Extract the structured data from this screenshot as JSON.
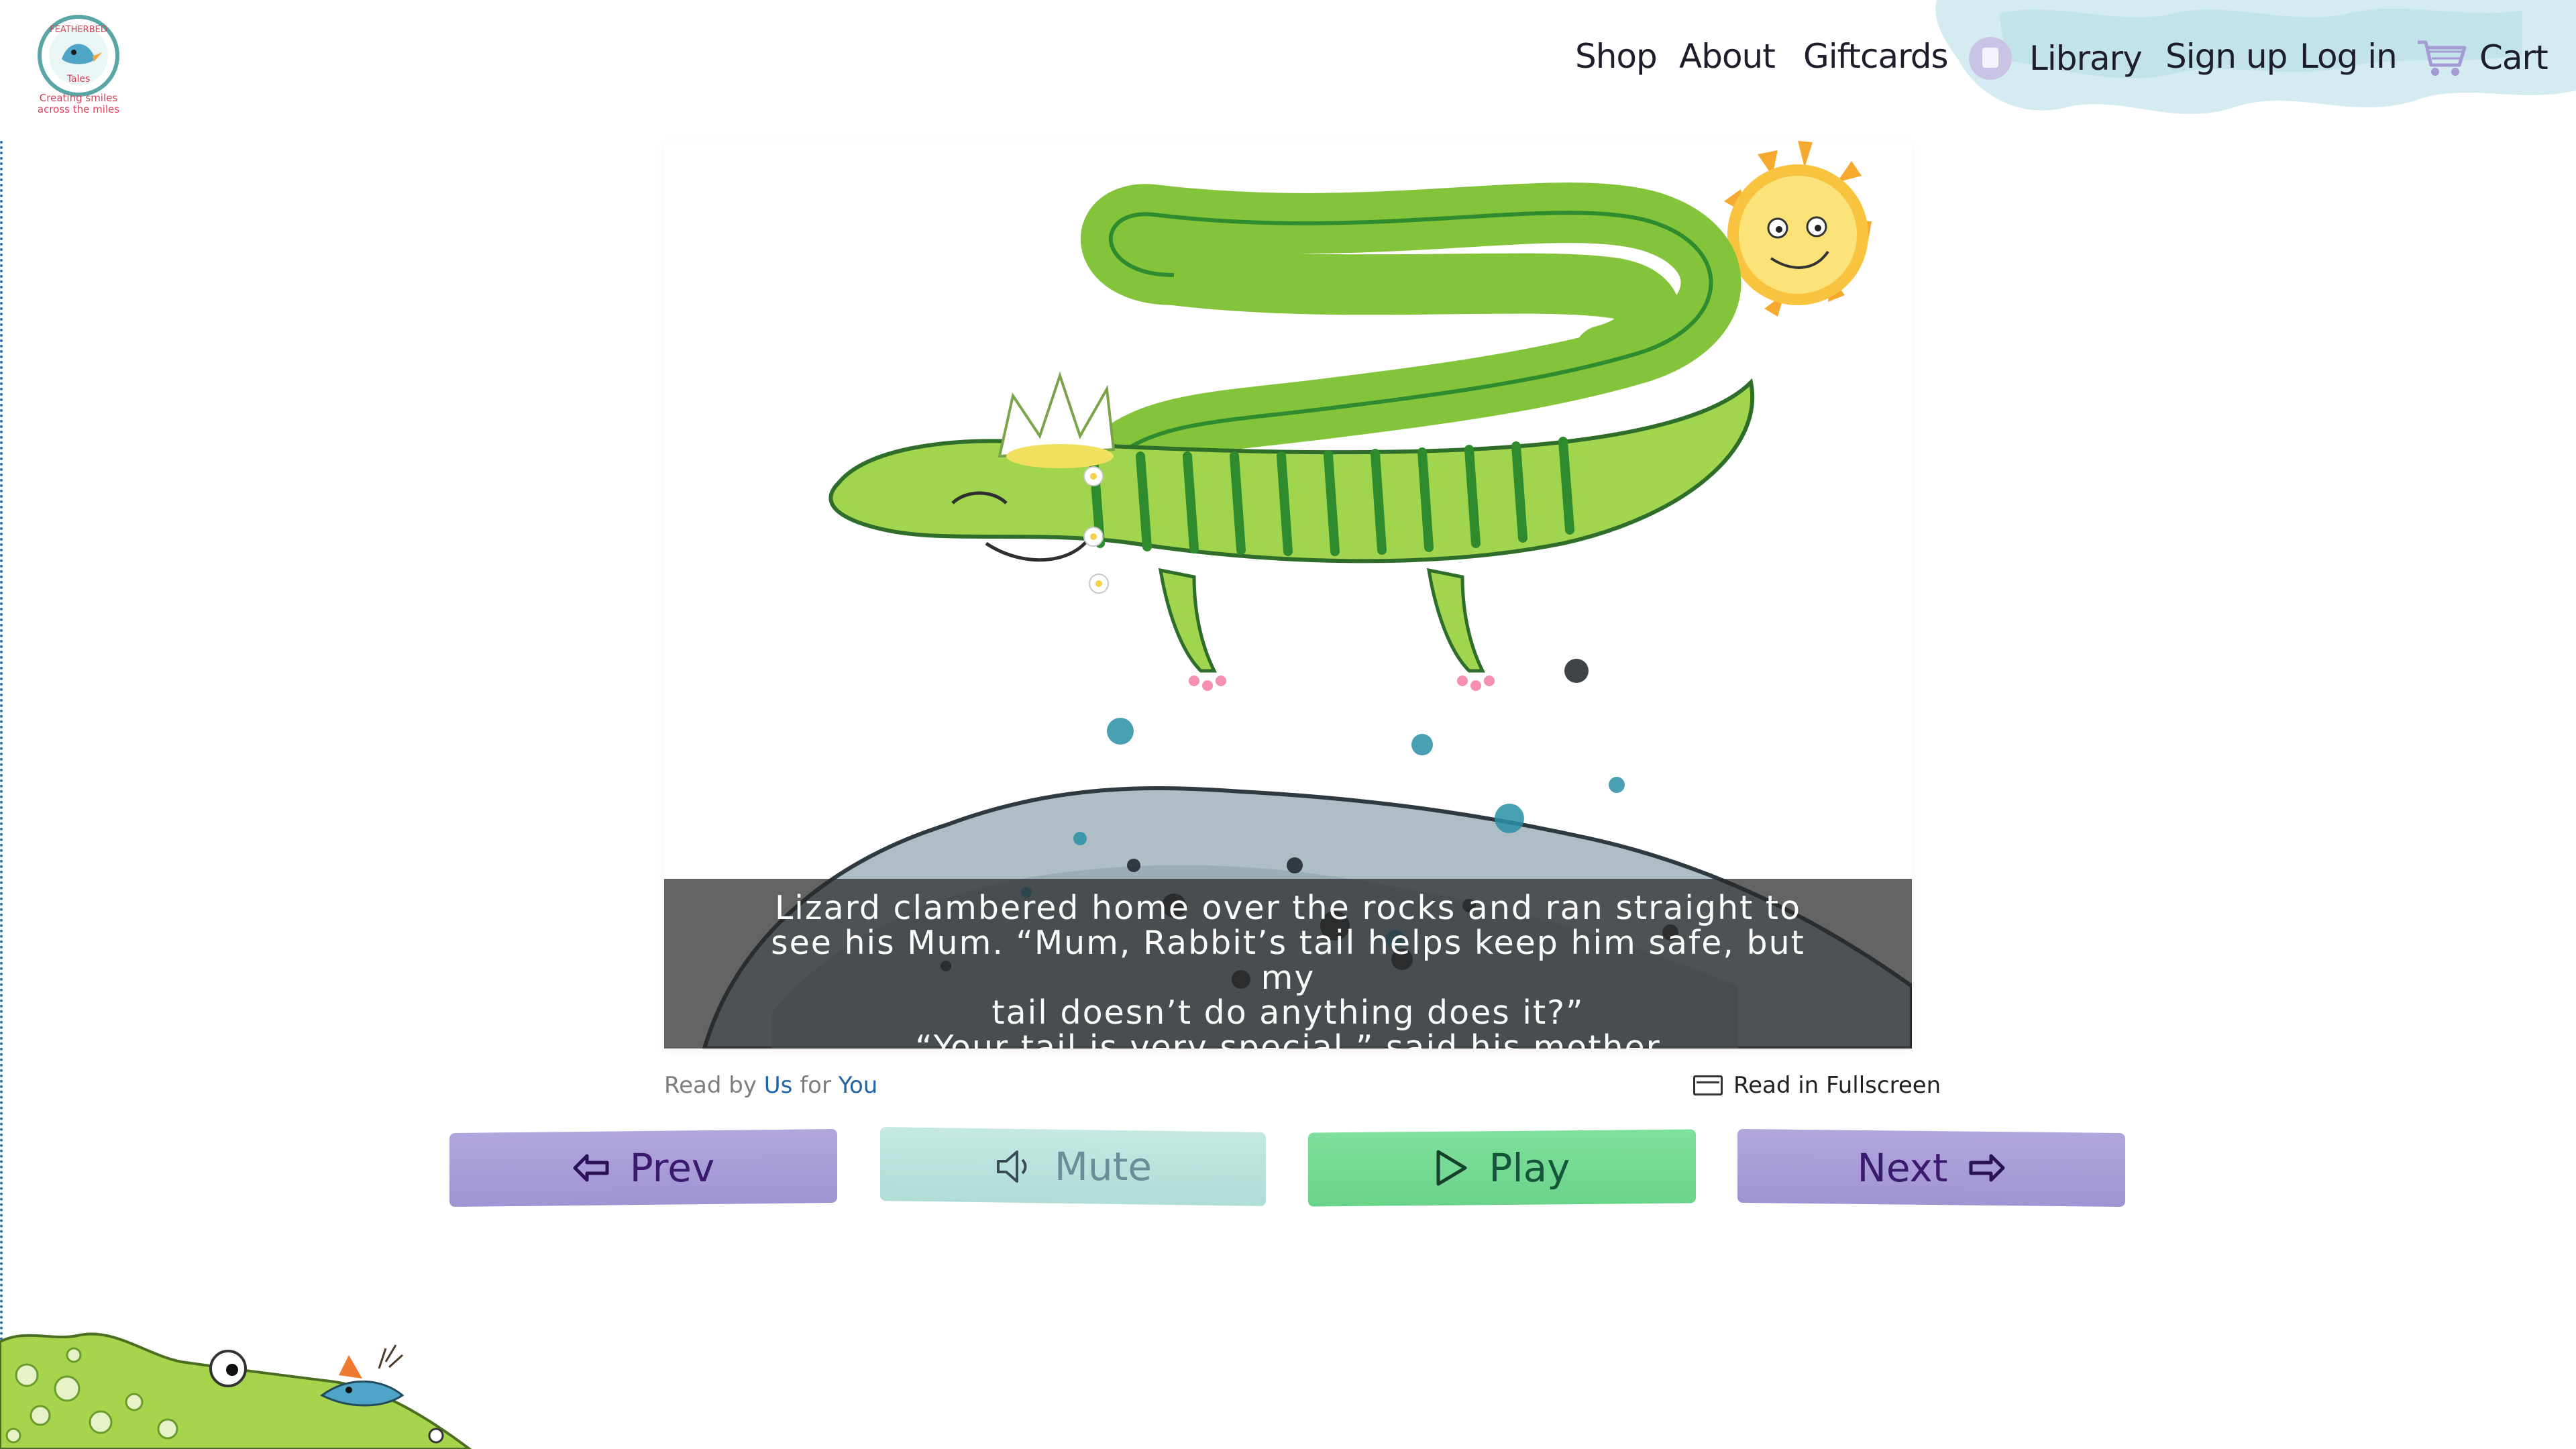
{
  "brand": {
    "name": "FEATHERBED Tales",
    "tagline_line1": "Creating smiles",
    "tagline_line2": "across the miles"
  },
  "nav": {
    "shop": "Shop",
    "about": "About",
    "giftcards": "Giftcards",
    "library": "Library",
    "signup": "Sign up",
    "login": "Log in",
    "cart": "Cart"
  },
  "story": {
    "caption_line1": "Lizard clambered home over the rocks and ran straight to",
    "caption_line2": "see his Mum.  “Mum, Rabbit’s tail helps keep him safe, but my",
    "caption_line3": "tail doesn’t do anything does it?”",
    "caption_line4": "“Your tail is very special,” said his mother"
  },
  "reader": {
    "read_by": "Read by",
    "us": "Us",
    "for": "for",
    "you": "You",
    "fullscreen": "Read in Fullscreen"
  },
  "controls": {
    "prev": "Prev",
    "mute": "Mute",
    "play": "Play",
    "next": "Next"
  },
  "colors": {
    "accent_link": "#1f63a8",
    "prev_next_bg": "#a99ed8",
    "mute_bg": "#bde3dd",
    "play_bg": "#74d993"
  }
}
